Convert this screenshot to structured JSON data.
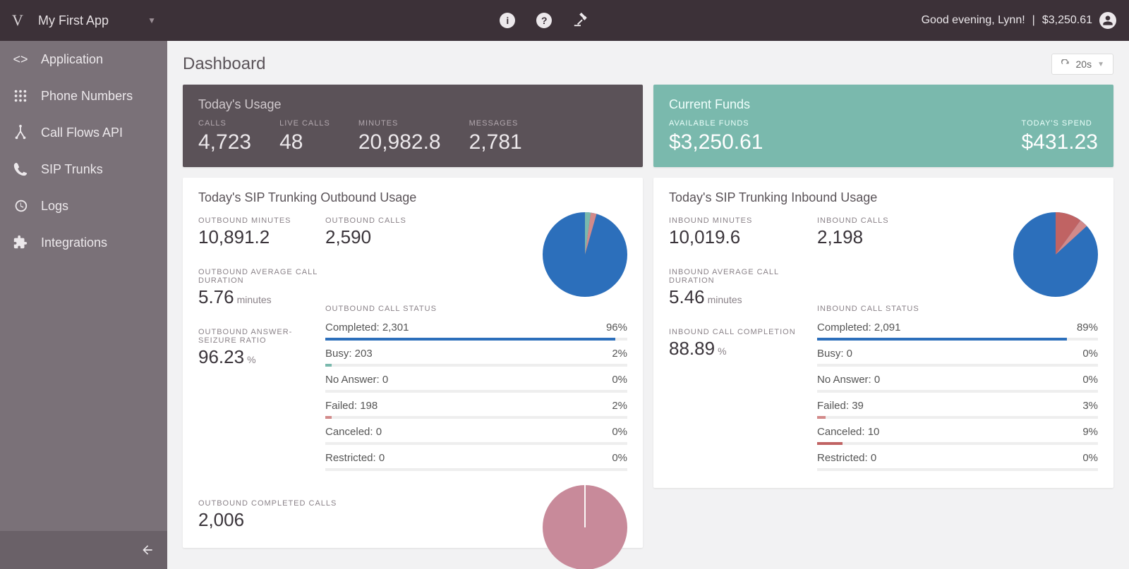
{
  "header": {
    "app_name": "My First App",
    "greeting_text": "Good evening, Lynn!",
    "greeting_sep": " | ",
    "balance": "$3,250.61"
  },
  "sidebar": {
    "items": [
      {
        "label": "Application",
        "icon": "code"
      },
      {
        "label": "Phone Numbers",
        "icon": "dialpad"
      },
      {
        "label": "Call Flows API",
        "icon": "flow"
      },
      {
        "label": "SIP Trunks",
        "icon": "sip"
      },
      {
        "label": "Logs",
        "icon": "history"
      },
      {
        "label": "Integrations",
        "icon": "puzzle"
      }
    ]
  },
  "page": {
    "title": "Dashboard",
    "refresh": "20s"
  },
  "usage_today": {
    "title": "Today's Usage",
    "calls_label": "CALLS",
    "calls": "4,723",
    "live_label": "LIVE CALLS",
    "live": "48",
    "minutes_label": "MINUTES",
    "minutes": "20,982.8",
    "messages_label": "MESSAGES",
    "messages": "2,781"
  },
  "funds": {
    "title": "Current Funds",
    "avail_label": "AVAILABLE FUNDS",
    "avail": "$3,250.61",
    "spend_label": "TODAY'S SPEND",
    "spend": "$431.23"
  },
  "outbound": {
    "title": "Today's SIP Trunking Outbound Usage",
    "minutes_label": "OUTBOUND MINUTES",
    "minutes": "10,891.2",
    "calls_label": "OUTBOUND CALLS",
    "calls": "2,590",
    "avg_label": "OUTBOUND AVERAGE CALL DURATION",
    "avg": "5.76",
    "avg_unit": "minutes",
    "asr_label": "OUTBOUND ANSWER-SEIZURE RATIO",
    "asr": "96.23",
    "asr_unit": "%",
    "status_title": "OUTBOUND CALL STATUS",
    "status": [
      {
        "label": "Completed",
        "value": "2,301",
        "pct": "96%",
        "width": 96,
        "color": "c-blue"
      },
      {
        "label": "Busy",
        "value": "203",
        "pct": "2%",
        "width": 2,
        "color": "c-teal"
      },
      {
        "label": "No Answer",
        "value": "0",
        "pct": "0%",
        "width": 0,
        "color": "c-gray"
      },
      {
        "label": "Failed",
        "value": "198",
        "pct": "2%",
        "width": 2,
        "color": "c-red"
      },
      {
        "label": "Canceled",
        "value": "0",
        "pct": "0%",
        "width": 0,
        "color": "c-dred"
      },
      {
        "label": "Restricted",
        "value": "0",
        "pct": "0%",
        "width": 0,
        "color": "c-lgray"
      }
    ],
    "completed_label": "OUTBOUND COMPLETED CALLS",
    "completed": "2,006"
  },
  "inbound": {
    "title": "Today's SIP Trunking Inbound Usage",
    "minutes_label": "INBOUND MINUTES",
    "minutes": "10,019.6",
    "calls_label": "INBOUND CALLS",
    "calls": "2,198",
    "avg_label": "INBOUND AVERAGE CALL DURATION",
    "avg": "5.46",
    "avg_unit": "minutes",
    "completion_label": "INBOUND CALL COMPLETION",
    "completion": "88.89",
    "completion_unit": "%",
    "status_title": "INBOUND CALL STATUS",
    "status": [
      {
        "label": "Completed",
        "value": "2,091",
        "pct": "89%",
        "width": 89,
        "color": "c-blue"
      },
      {
        "label": "Busy",
        "value": "0",
        "pct": "0%",
        "width": 0,
        "color": "c-teal"
      },
      {
        "label": "No Answer",
        "value": "0",
        "pct": "0%",
        "width": 0,
        "color": "c-gray"
      },
      {
        "label": "Failed",
        "value": "39",
        "pct": "3%",
        "width": 3,
        "color": "c-red"
      },
      {
        "label": "Canceled",
        "value": "10",
        "pct": "9%",
        "width": 9,
        "color": "c-dred"
      },
      {
        "label": "Restricted",
        "value": "0",
        "pct": "0%",
        "width": 0,
        "color": "c-lgray"
      }
    ]
  },
  "chart_data": [
    {
      "type": "pie",
      "title": "Outbound Call Status",
      "series": [
        {
          "name": "Completed",
          "value": 96
        },
        {
          "name": "Busy",
          "value": 2
        },
        {
          "name": "Failed",
          "value": 2
        }
      ]
    },
    {
      "type": "pie",
      "title": "Inbound Call Status",
      "series": [
        {
          "name": "Completed",
          "value": 89
        },
        {
          "name": "Failed",
          "value": 3
        },
        {
          "name": "Canceled",
          "value": 9
        }
      ]
    },
    {
      "type": "pie",
      "title": "Outbound Completed Calls",
      "series": [
        {
          "name": "Completed",
          "value": 100
        }
      ]
    }
  ]
}
